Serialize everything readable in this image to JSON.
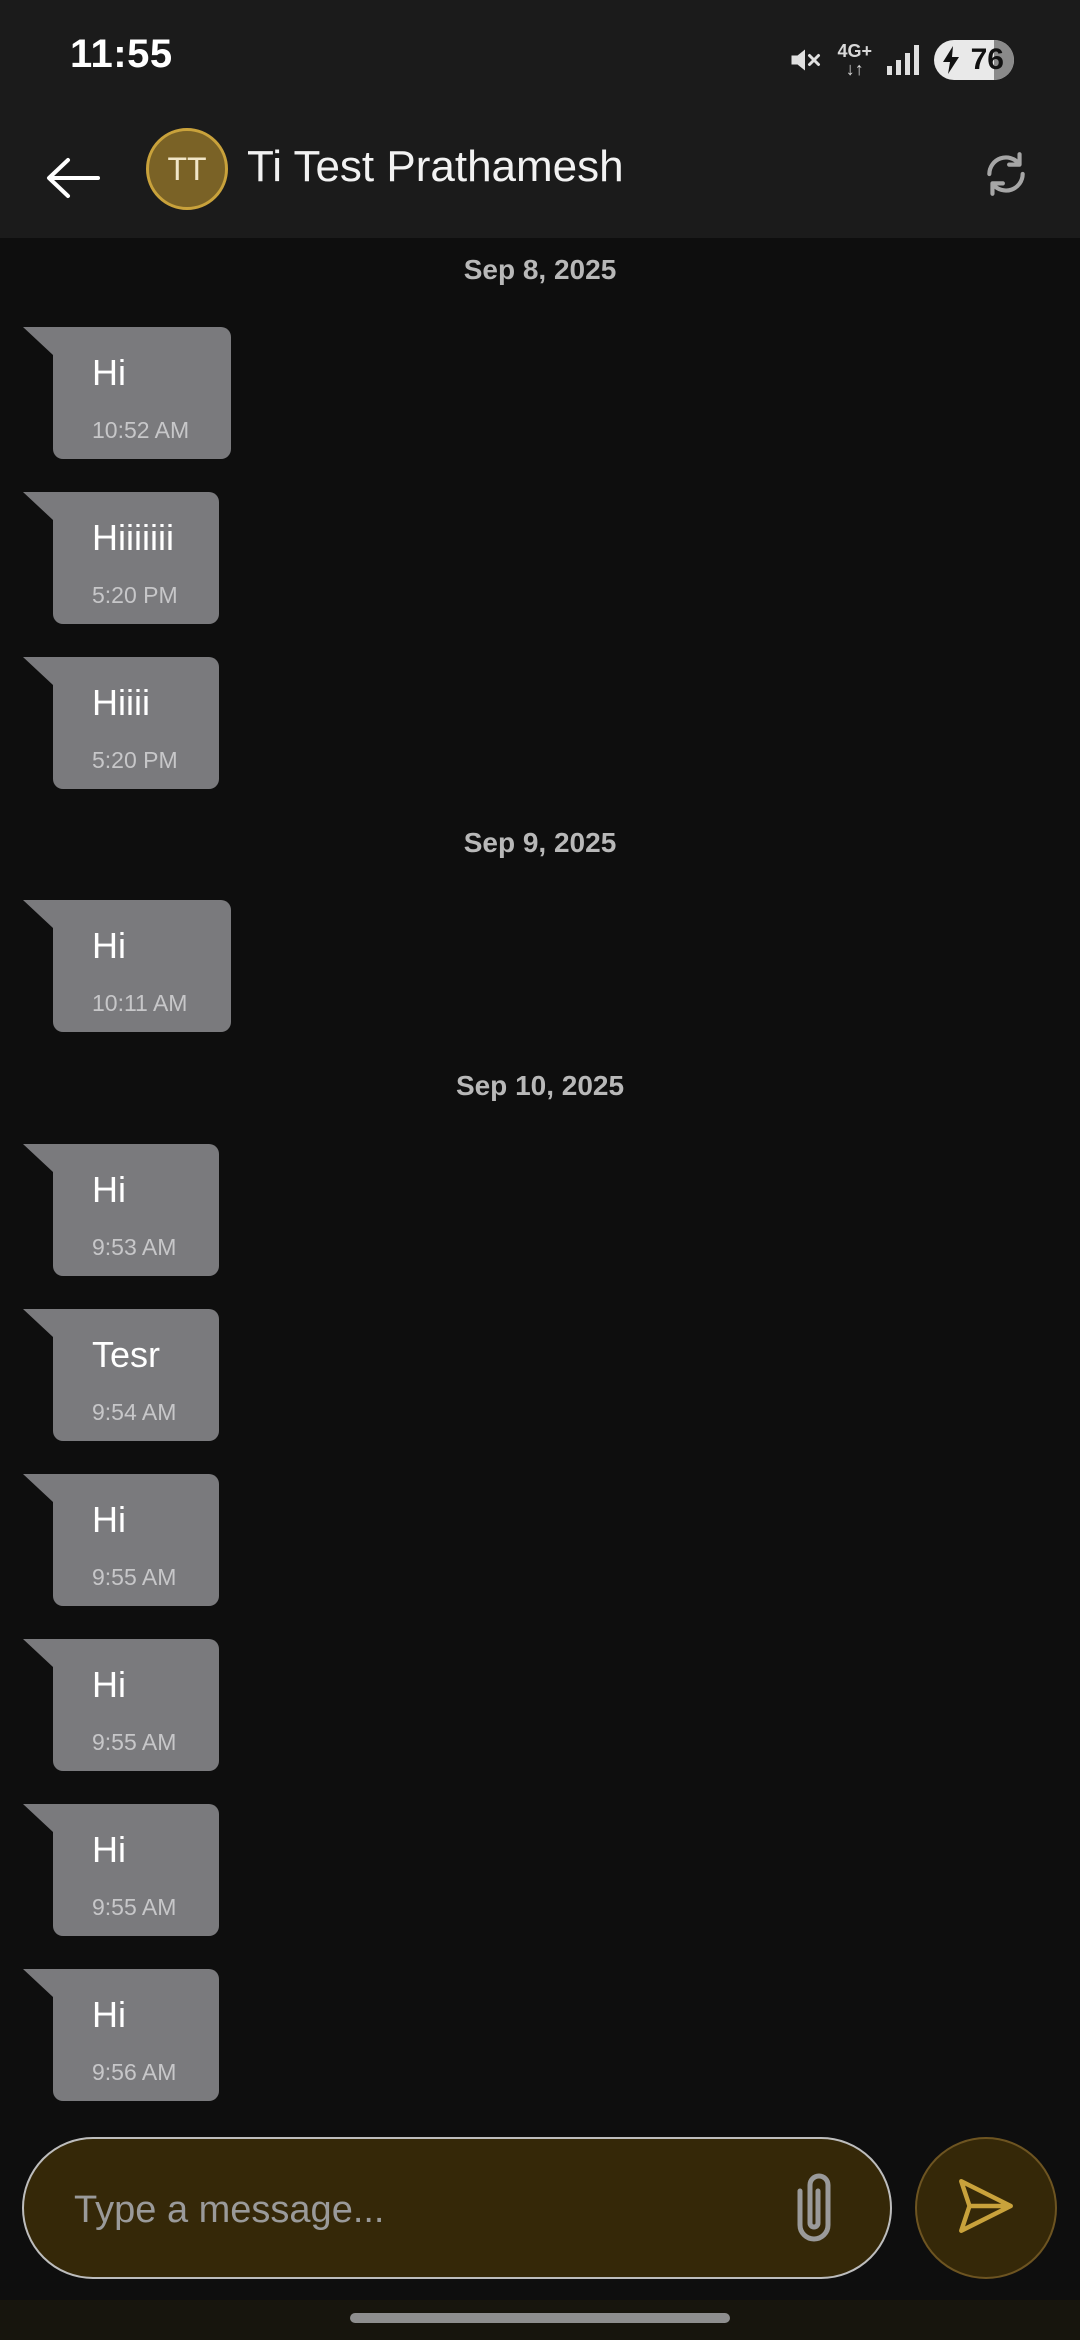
{
  "status_bar": {
    "time": "11:55",
    "network": "4G+",
    "battery": "76"
  },
  "header": {
    "avatar_initials": "TT",
    "contact_name": "Ti Test Prathamesh"
  },
  "groups": [
    {
      "date": "Sep 8, 2025",
      "messages": [
        {
          "text": "Hi",
          "time": "10:52 AM"
        },
        {
          "text": "Hiiiiiii",
          "time": "5:20 PM"
        },
        {
          "text": "Hiiii",
          "time": "5:20 PM"
        }
      ]
    },
    {
      "date": "Sep 9, 2025",
      "messages": [
        {
          "text": "Hi",
          "time": "10:11 AM"
        }
      ]
    },
    {
      "date": "Sep 10, 2025",
      "messages": [
        {
          "text": "Hi",
          "time": "9:53 AM"
        },
        {
          "text": "Tesr",
          "time": "9:54 AM"
        },
        {
          "text": "Hi",
          "time": "9:55 AM"
        },
        {
          "text": "Hi",
          "time": "9:55 AM"
        },
        {
          "text": "Hi",
          "time": "9:55 AM"
        },
        {
          "text": "Hi",
          "time": "9:56 AM"
        }
      ]
    }
  ],
  "composer": {
    "placeholder": "Type a message...",
    "value": ""
  },
  "colors": {
    "accent": "#c9a23b",
    "bubble": "#7a7a7d",
    "background": "#0e0e0e",
    "header": "#1b1b1b",
    "composer": "#352808"
  },
  "icons": {
    "back": "arrow-left-icon",
    "refresh": "refresh-icon",
    "attach": "paperclip-icon",
    "send": "send-icon"
  }
}
